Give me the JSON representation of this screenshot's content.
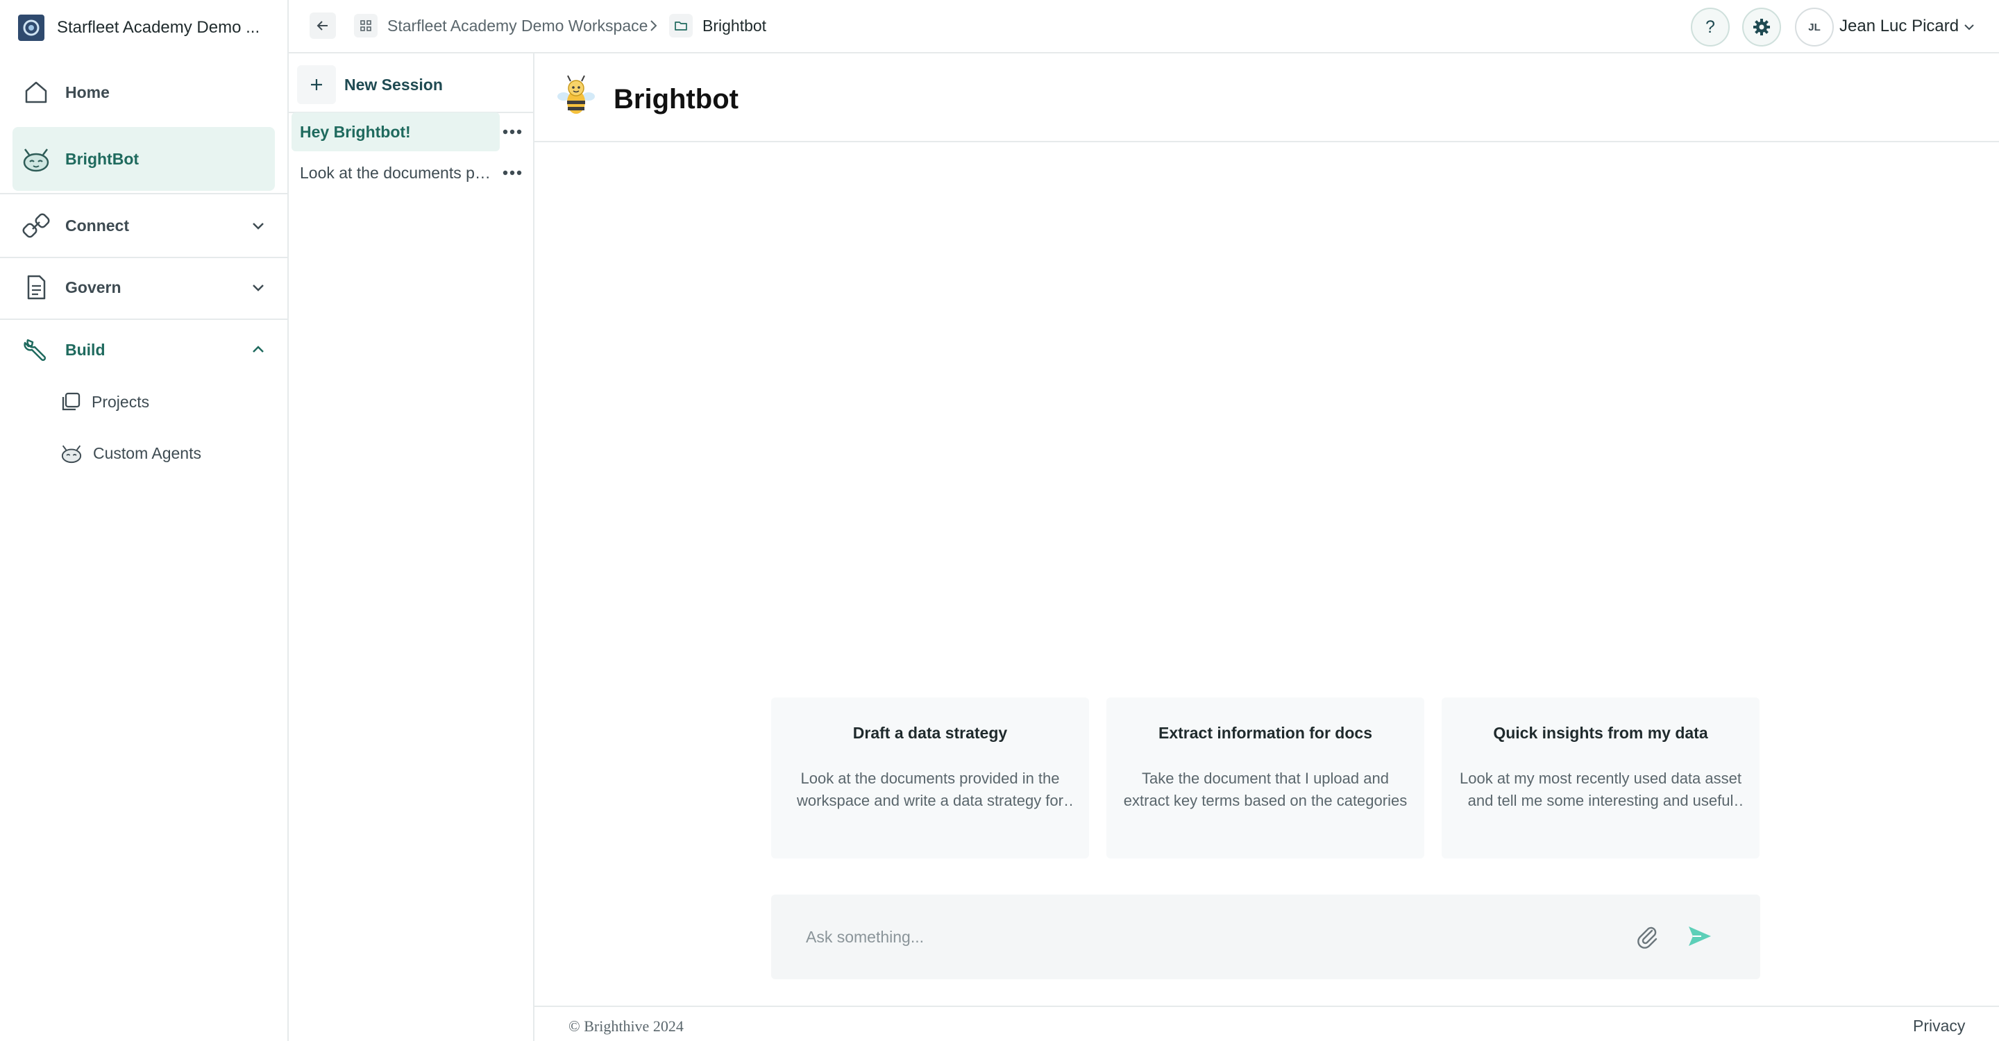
{
  "workspace": {
    "name": "Starfleet Academy Demo ..."
  },
  "nav": {
    "home": "Home",
    "brightbot": "BrightBot",
    "connect": "Connect",
    "govern": "Govern",
    "build": "Build",
    "projects": "Projects",
    "custom_agents": "Custom Agents"
  },
  "breadcrumb": {
    "workspace": "Starfleet Academy Demo Workspace",
    "current": "Brightbot"
  },
  "user": {
    "initials": "JL",
    "name": "Jean Luc Picard"
  },
  "help_label": "?",
  "sessions": {
    "new_label": "New Session",
    "items": [
      {
        "label": "Hey Brightbot!",
        "active": true
      },
      {
        "label": "Look at the documents provided in the workspace",
        "active": false
      }
    ]
  },
  "main": {
    "title": "Brightbot"
  },
  "suggestions": [
    {
      "title": "Draft a data strategy",
      "desc": "Look at the documents provided in the workspace and write a data strategy for the organization"
    },
    {
      "title": "Extract information for docs",
      "desc": "Take the document that I upload and extract key terms based on the categories"
    },
    {
      "title": "Quick insights from my data",
      "desc": "Look at my most recently used data asset and tell me some interesting and useful insights"
    }
  ],
  "ask": {
    "placeholder": "Ask something..."
  },
  "footer": {
    "copyright": "© Brighthive 2024",
    "privacy": "Privacy"
  },
  "colors": {
    "accent": "#1f6a5e",
    "accent_bg": "#e8f4f1",
    "send": "#5ccfb8"
  }
}
